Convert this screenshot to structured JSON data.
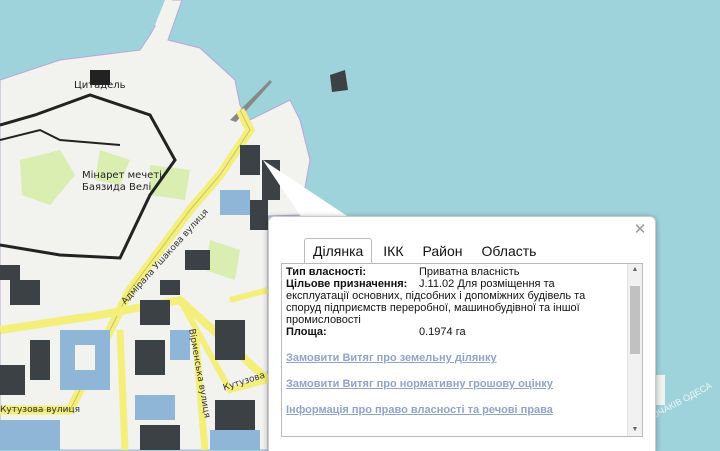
{
  "map": {
    "labels": {
      "citadel": "Цитадель",
      "minaret_line1": "Мінарет мечеті",
      "minaret_line2": "Баязида Велі",
      "street_1": "Адмірала Ушакова вулиця",
      "street_2": "Кутузова вулиця",
      "street_3": "Кутузова вулиця",
      "street_4": "Вірменська вулиця"
    },
    "watermark": "вСЕ ОЧАКІВ ОДЕСА",
    "colors": {
      "sea": "#9fd3dc",
      "land": "#f2f2ef",
      "park": "#d9eeb0",
      "road": "#f3ef7a",
      "building": "#3b4145",
      "building_highlight": "#8fb6d6"
    }
  },
  "popup": {
    "close_icon": "✕",
    "tabs": [
      "Ділянка",
      "ІКК",
      "Район",
      "Область"
    ],
    "active_tab": "Ділянка",
    "ownership_label": "Тип власності:",
    "ownership_value": "Приватна власність",
    "purpose_label": "Цільове призначення:",
    "purpose_value_line1": "J.11.02 Для розміщення та",
    "purpose_value_rest": "експлуатації основних, підсобних і допоміжних будівель та споруд підприємств переробної, машинобудівної та іншої промисловості",
    "area_label": "Площа:",
    "area_value": "0.1974 га",
    "links": [
      "Замовити Витяг про земельну ділянку",
      "Замовити Витяг про нормативну грошову оцінку",
      "Інформація про право власності та речові права"
    ],
    "scrollbar": {
      "position": 0.12
    }
  }
}
